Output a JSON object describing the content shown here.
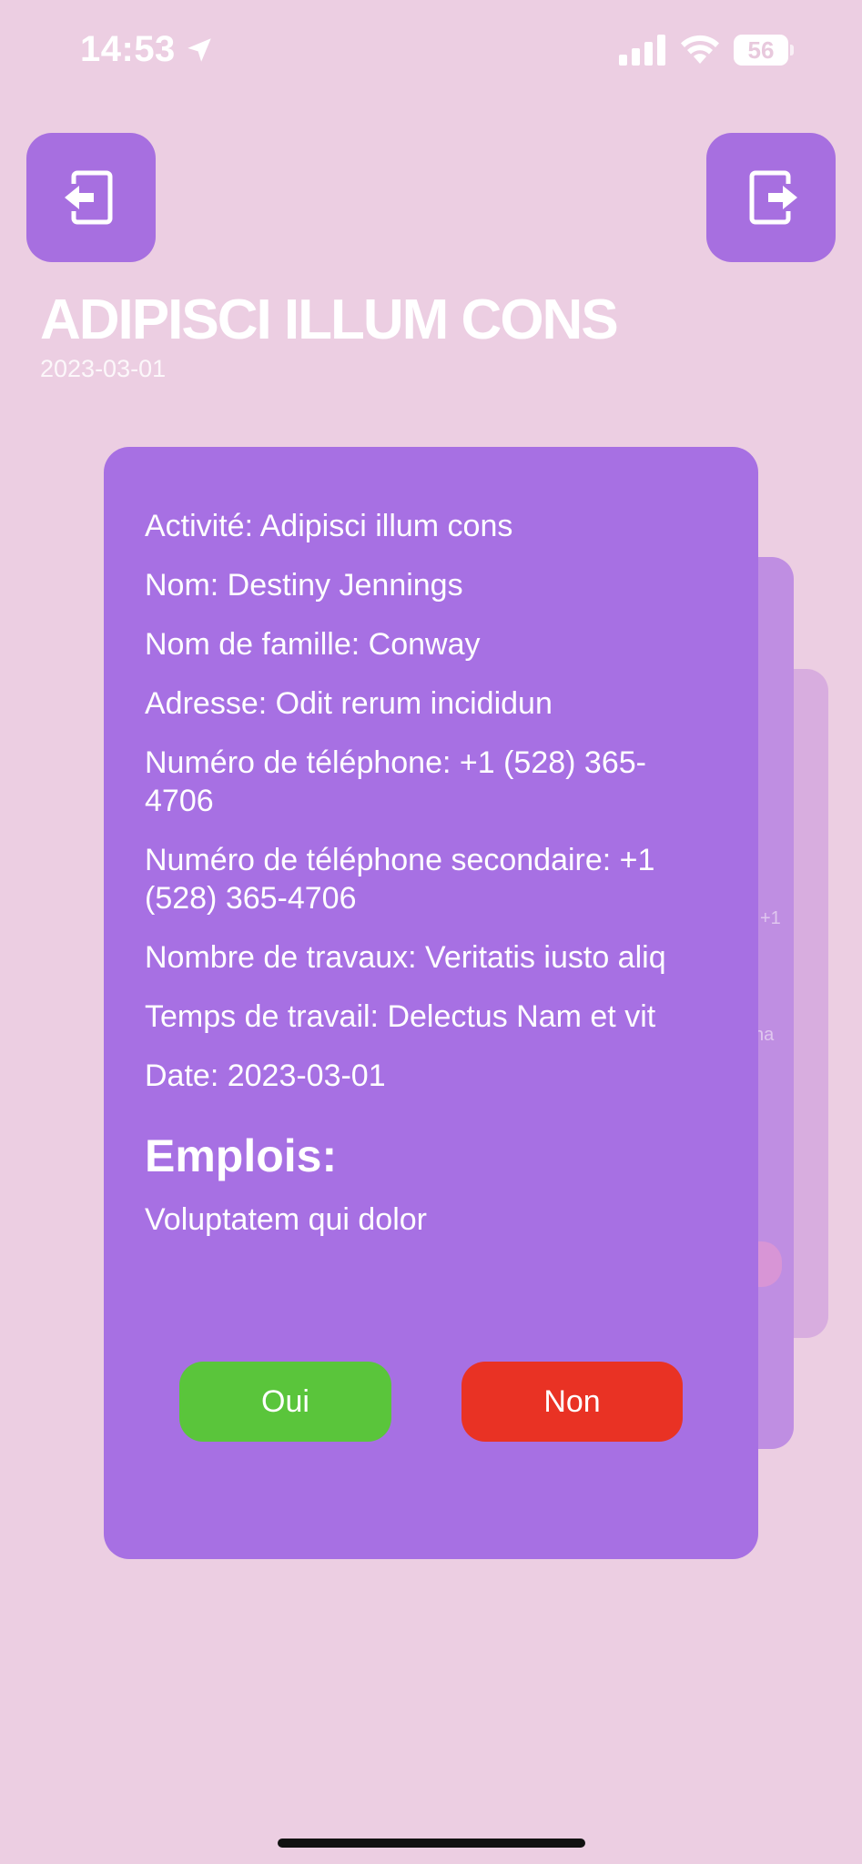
{
  "status_bar": {
    "time": "14:53",
    "battery_level": "56"
  },
  "header": {
    "title": "ADIPISCI ILLUM CONS",
    "subtitle": "2023-03-01"
  },
  "card": {
    "fields": [
      "Activité: Adipisci illum cons",
      "Nom: Destiny Jennings",
      "Nom de famille: Conway",
      "Adresse: Odit rerum incididun",
      "Numéro de téléphone: +1 (528) 365-4706",
      "Numéro de téléphone secondaire: +1 (528) 365-4706",
      "Nombre de travaux: Veritatis iusto aliq",
      "Temps de travail: Delectus Nam et vit",
      "Date: 2023-03-01"
    ],
    "emplois_title": "Emplois:",
    "emplois_value": "Voluptatem qui dolor",
    "yes_label": "Oui",
    "no_label": "Non"
  },
  "back_cards": {
    "ghost_text_1": "+1",
    "ghost_text_2": "na"
  },
  "colors": {
    "background": "#eccee2",
    "card": "#a770e3",
    "accent_button": "#a76fe0",
    "yes": "#5ac53b",
    "no": "#e93224"
  },
  "icons": {
    "nav_left": "exit-left-icon",
    "nav_right": "exit-right-icon",
    "location": "location-arrow-icon",
    "signal": "signal-icon",
    "wifi": "wifi-icon"
  }
}
